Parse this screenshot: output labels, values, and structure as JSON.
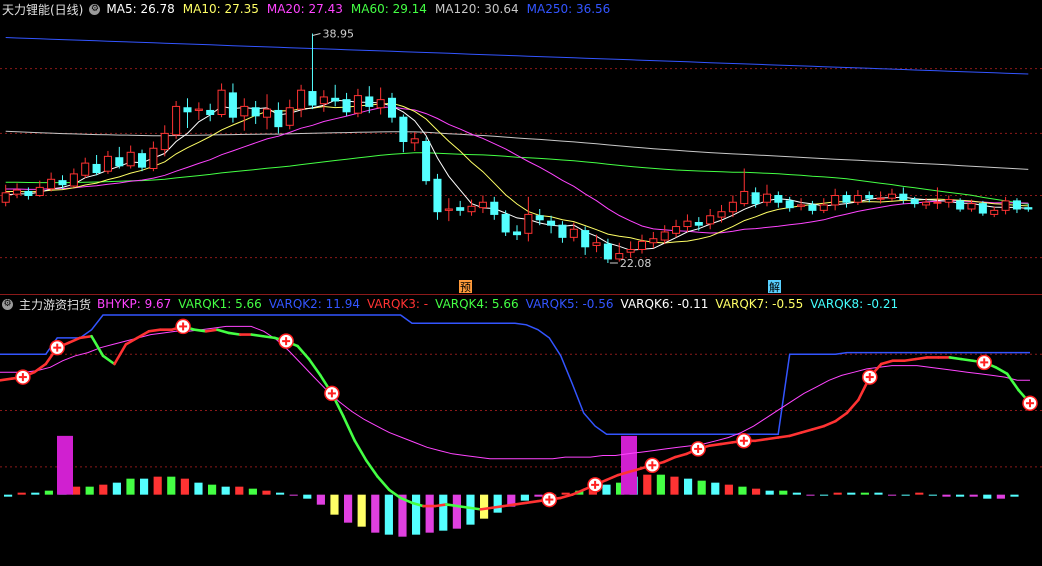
{
  "top_panel": {
    "title": "天力锂能(日线)",
    "legend": [
      {
        "name": "MA5:",
        "value": "26.78",
        "color": "#ffffff"
      },
      {
        "name": "MA10:",
        "value": "27.35",
        "color": "#ffff66"
      },
      {
        "name": "MA20:",
        "value": "27.43",
        "color": "#ff44ff"
      },
      {
        "name": "MA60:",
        "value": "29.14",
        "color": "#44ff44"
      },
      {
        "name": "MA120:",
        "value": "30.64",
        "color": "#c8c8c8"
      },
      {
        "name": "MA250:",
        "value": "36.56",
        "color": "#3355ff"
      }
    ],
    "high_label": "38.95",
    "low_label": "22.08",
    "marker_yu": "预",
    "marker_jie": "解"
  },
  "bottom_panel": {
    "title": "主力游资扫货",
    "legend": [
      {
        "name": "BHYKP:",
        "value": "9.67",
        "color": "#ff44ff"
      },
      {
        "name": "VARQK1:",
        "value": "5.66",
        "color": "#44ff44"
      },
      {
        "name": "VARQK2:",
        "value": "11.94",
        "color": "#3355ff"
      },
      {
        "name": "VARQK3:",
        "value": "-",
        "color": "#ff3333"
      },
      {
        "name": "VARQK4:",
        "value": "5.66",
        "color": "#44ff44"
      },
      {
        "name": "VARQK5:",
        "value": "-0.56",
        "color": "#3355ff"
      },
      {
        "name": "VARQK6:",
        "value": "-0.11",
        "color": "#ffffff"
      },
      {
        "name": "VARQK7:",
        "value": "-0.55",
        "color": "#ffff66"
      },
      {
        "name": "VARQK8:",
        "value": "-0.21",
        "color": "#44ffff"
      }
    ]
  },
  "chart_data": [
    {
      "type": "candlestick",
      "title": "天力锂能(日线)",
      "ylim": [
        20,
        40
      ],
      "annotations": [
        {
          "text": "38.95",
          "kind": "high"
        },
        {
          "text": "22.08",
          "kind": "low"
        }
      ],
      "candles": [
        [
          26.5,
          27.2,
          27.8,
          26.2
        ],
        [
          27.1,
          27.4,
          27.9,
          26.8
        ],
        [
          27.3,
          27.0,
          27.6,
          26.7
        ],
        [
          27.0,
          27.6,
          28.1,
          26.9
        ],
        [
          27.5,
          28.2,
          28.7,
          27.3
        ],
        [
          28.1,
          27.8,
          28.5,
          27.5
        ],
        [
          27.7,
          28.6,
          29.0,
          27.6
        ],
        [
          28.5,
          29.4,
          29.8,
          28.3
        ],
        [
          29.3,
          28.7,
          30.0,
          28.5
        ],
        [
          28.8,
          29.9,
          30.3,
          28.6
        ],
        [
          29.8,
          29.2,
          30.6,
          29.0
        ],
        [
          29.2,
          30.2,
          30.7,
          29.0
        ],
        [
          30.1,
          29.1,
          30.4,
          28.8
        ],
        [
          29.0,
          30.5,
          31.0,
          28.8
        ],
        [
          30.4,
          31.6,
          32.2,
          29.9
        ],
        [
          31.5,
          33.6,
          34.0,
          31.2
        ],
        [
          33.5,
          33.2,
          34.2,
          32.0
        ],
        [
          33.3,
          33.4,
          33.9,
          32.6
        ],
        [
          33.3,
          33.0,
          33.8,
          32.5
        ],
        [
          33.0,
          34.8,
          35.3,
          32.8
        ],
        [
          34.6,
          32.8,
          35.3,
          32.4
        ],
        [
          32.9,
          33.6,
          34.2,
          31.8
        ],
        [
          33.5,
          32.9,
          34.0,
          32.3
        ],
        [
          32.8,
          33.4,
          34.5,
          31.9
        ],
        [
          33.3,
          32.1,
          33.9,
          31.6
        ],
        [
          32.2,
          33.5,
          34.1,
          31.9
        ],
        [
          33.4,
          34.8,
          35.2,
          32.8
        ],
        [
          34.7,
          33.7,
          39.0,
          33.4
        ],
        [
          33.8,
          34.3,
          34.8,
          33.2
        ],
        [
          34.2,
          34.0,
          35.2,
          33.6
        ],
        [
          34.1,
          33.2,
          34.6,
          32.9
        ],
        [
          33.1,
          34.4,
          34.9,
          32.8
        ],
        [
          34.3,
          33.6,
          35.1,
          33.1
        ],
        [
          33.5,
          34.1,
          35.0,
          33.0
        ],
        [
          34.2,
          32.8,
          34.6,
          32.4
        ],
        [
          32.8,
          31.0,
          33.0,
          30.2
        ],
        [
          30.9,
          31.2,
          31.7,
          30.3
        ],
        [
          31.0,
          28.1,
          31.3,
          27.8
        ],
        [
          28.2,
          25.8,
          28.6,
          25.2
        ],
        [
          25.9,
          26.0,
          26.8,
          25.1
        ],
        [
          26.1,
          25.9,
          26.6,
          25.5
        ],
        [
          25.8,
          26.2,
          26.7,
          25.5
        ],
        [
          26.1,
          26.5,
          27.0,
          25.7
        ],
        [
          26.5,
          25.6,
          26.9,
          25.2
        ],
        [
          25.6,
          24.3,
          25.9,
          24.0
        ],
        [
          24.3,
          24.1,
          24.8,
          23.7
        ],
        [
          24.2,
          25.6,
          26.9,
          23.6
        ],
        [
          25.5,
          25.2,
          26.0,
          24.8
        ],
        [
          25.1,
          24.8,
          25.5,
          24.2
        ],
        [
          24.8,
          23.9,
          25.1,
          23.5
        ],
        [
          23.9,
          24.5,
          25.0,
          23.6
        ],
        [
          24.4,
          23.2,
          24.7,
          22.6
        ],
        [
          23.3,
          23.5,
          24.1,
          22.8
        ],
        [
          23.4,
          22.3,
          23.8,
          22.0
        ],
        [
          22.3,
          22.7,
          23.5,
          22.1
        ],
        [
          22.8,
          23.0,
          23.6,
          22.4
        ],
        [
          23.0,
          23.6,
          24.1,
          22.7
        ],
        [
          23.5,
          23.8,
          24.3,
          23.1
        ],
        [
          23.7,
          24.3,
          24.8,
          23.4
        ],
        [
          24.2,
          24.7,
          25.2,
          23.9
        ],
        [
          24.7,
          25.1,
          25.6,
          24.3
        ],
        [
          25.0,
          24.8,
          25.4,
          24.4
        ],
        [
          24.9,
          25.5,
          26.0,
          24.5
        ],
        [
          25.4,
          25.8,
          26.3,
          25.0
        ],
        [
          25.8,
          26.5,
          27.0,
          25.4
        ],
        [
          26.4,
          27.3,
          29.0,
          26.2
        ],
        [
          27.2,
          26.4,
          27.6,
          26.1
        ],
        [
          26.5,
          27.1,
          27.8,
          26.2
        ],
        [
          27.0,
          26.5,
          27.3,
          26.1
        ],
        [
          26.6,
          26.1,
          26.9,
          25.8
        ],
        [
          26.2,
          26.3,
          26.8,
          25.9
        ],
        [
          26.3,
          25.9,
          26.6,
          25.6
        ],
        [
          25.9,
          26.3,
          26.8,
          25.7
        ],
        [
          26.3,
          27.0,
          27.5,
          25.9
        ],
        [
          27.0,
          26.5,
          27.3,
          26.1
        ],
        [
          26.5,
          27.0,
          27.4,
          26.3
        ],
        [
          27.0,
          26.8,
          27.3,
          26.5
        ],
        [
          26.8,
          26.8,
          27.3,
          26.4
        ],
        [
          26.8,
          27.1,
          27.5,
          26.6
        ],
        [
          27.1,
          26.7,
          27.6,
          26.4
        ],
        [
          26.7,
          26.4,
          26.9,
          26.1
        ],
        [
          26.3,
          26.5,
          26.8,
          26.0
        ],
        [
          26.5,
          26.5,
          27.6,
          26.0
        ],
        [
          26.5,
          26.7,
          27.0,
          26.1
        ],
        [
          26.6,
          26.0,
          26.8,
          25.8
        ],
        [
          26.0,
          26.4,
          26.7,
          25.8
        ],
        [
          26.4,
          25.7,
          26.6,
          25.5
        ],
        [
          25.6,
          25.9,
          26.2,
          25.4
        ],
        [
          25.9,
          26.6,
          26.9,
          25.6
        ],
        [
          26.6,
          26.0,
          26.8,
          25.7
        ],
        [
          26.1,
          26.0,
          26.4,
          25.8
        ]
      ]
    },
    {
      "type": "line",
      "title": "主力游资扫货",
      "ylim": [
        -40,
        110
      ],
      "series": [
        {
          "name": "VARQK1",
          "values": [
            70,
            71,
            72,
            75,
            80,
            90,
            93,
            96,
            97,
            85,
            80,
            92,
            96,
            100,
            101,
            101,
            103,
            101,
            100,
            101,
            99,
            98,
            98,
            97,
            96,
            94,
            91,
            83,
            73,
            62,
            48,
            33,
            21,
            11,
            3,
            -2,
            -5,
            -7,
            -7,
            -6,
            -7,
            -8,
            -9,
            -8,
            -7,
            -6,
            -5,
            -4,
            -3,
            -2,
            0,
            3,
            6,
            9,
            12,
            14,
            16,
            18,
            20,
            23,
            25,
            28,
            30,
            31,
            32,
            33,
            33,
            34,
            35,
            36,
            38,
            40,
            42,
            45,
            50,
            58,
            72,
            80,
            82,
            82,
            83,
            84,
            84,
            84,
            83,
            82,
            81,
            78,
            74,
            64,
            56
          ]
        },
        {
          "name": "VARQK2",
          "values": [
            86,
            86,
            86,
            86,
            86,
            96,
            96,
            96,
            101,
            110,
            110,
            110,
            110,
            110,
            110,
            110,
            110,
            110,
            110,
            110,
            110,
            110,
            110,
            110,
            110,
            110,
            110,
            110,
            110,
            110,
            110,
            110,
            110,
            110,
            110,
            110,
            105,
            105,
            105,
            105,
            105,
            105,
            105,
            105,
            105,
            105,
            104,
            101,
            96,
            85,
            68,
            50,
            42,
            37,
            37,
            37,
            37,
            37,
            37,
            37,
            37,
            37,
            37,
            37,
            37,
            37,
            37,
            37,
            37,
            86,
            86,
            86,
            86,
            86,
            87,
            87,
            87,
            87,
            87,
            87,
            87,
            87,
            87,
            87,
            87,
            87,
            87,
            87,
            87,
            87,
            87
          ]
        },
        {
          "name": "BHYKP",
          "values": [
            75,
            75,
            75,
            76,
            78,
            82,
            85,
            87,
            90,
            92,
            94,
            96,
            98,
            99,
            100,
            100,
            101,
            102,
            103,
            103,
            103,
            100,
            95,
            88,
            80,
            72,
            64,
            57,
            51,
            46,
            42,
            38,
            35,
            32,
            29,
            27,
            25,
            24,
            23,
            22,
            22,
            22,
            22,
            22,
            22,
            23,
            23,
            23,
            24,
            24,
            25,
            26,
            27,
            28,
            29,
            30,
            31,
            33,
            35,
            38,
            42,
            47,
            52,
            57,
            62,
            66,
            70,
            73,
            75,
            77,
            78,
            79,
            79,
            79,
            78,
            77,
            76,
            75,
            74,
            73,
            72,
            70,
            70
          ]
        }
      ],
      "histogram": {
        "values": [
          -1,
          1,
          1,
          2,
          3,
          4,
          4,
          5,
          6,
          8,
          8,
          9,
          9,
          8,
          6,
          5,
          4,
          4,
          3,
          2,
          1,
          0,
          -2,
          -5,
          -10,
          -14,
          -16,
          -19,
          -20,
          -21,
          -20,
          -19,
          -18,
          -17,
          -15,
          -12,
          -9,
          -6,
          -3,
          -1,
          0,
          1,
          2,
          3,
          5,
          6,
          9,
          10,
          10,
          9,
          8,
          7,
          6,
          5,
          4,
          3,
          2,
          2,
          1,
          0,
          0,
          1,
          1,
          1,
          1,
          0,
          0,
          1,
          0,
          -1,
          -1,
          -1,
          -2,
          -2,
          -1
        ]
      },
      "signals_count": 15
    }
  ],
  "colors": {
    "up": "#ff3333",
    "down": "#54ffff",
    "ma5": "#ffffff",
    "ma10": "#ffff66",
    "ma20": "#ff44ff",
    "ma60": "#44ff44",
    "ma120": "#c8c8c8",
    "ma250": "#3355ff",
    "grid": "#8b1a1a"
  }
}
